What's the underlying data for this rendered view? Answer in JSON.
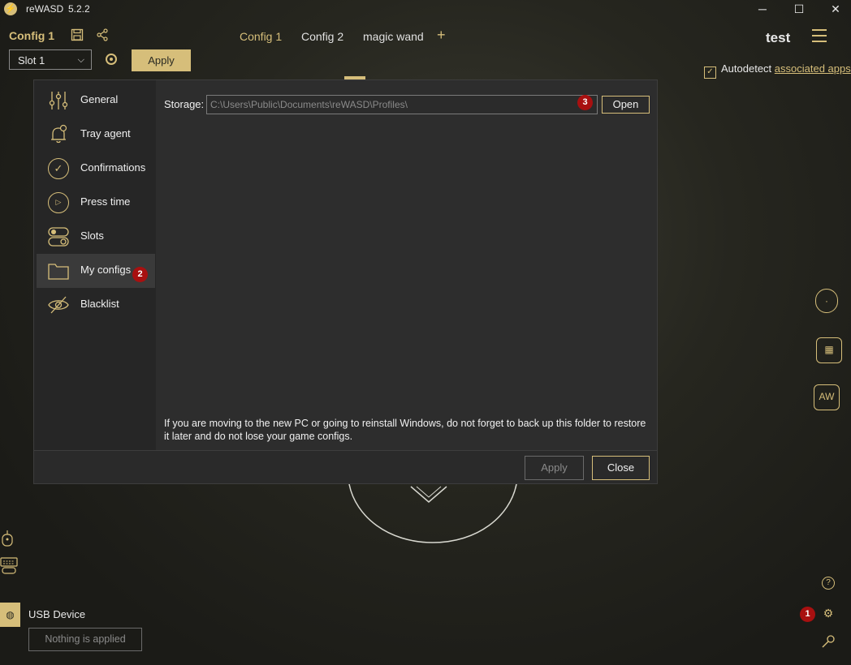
{
  "titlebar": {
    "app_name": "reWASD",
    "version": "5.2.2",
    "minimize": "─",
    "maximize": "☐",
    "close": "✕"
  },
  "header": {
    "config_title": "Config 1",
    "tabs": [
      {
        "label": "Config 1"
      },
      {
        "label": "Config 2"
      },
      {
        "label": "magic wand"
      }
    ],
    "add_tab": "+",
    "profile": "test"
  },
  "slot_row": {
    "slot_value": "Slot 1",
    "apply": "Apply"
  },
  "autodetect": {
    "label": "Autodetect",
    "link": "associated apps",
    "checked": true
  },
  "dialog": {
    "nav": [
      {
        "label": "General"
      },
      {
        "label": "Tray agent"
      },
      {
        "label": "Confirmations"
      },
      {
        "label": "Press time"
      },
      {
        "label": "Slots"
      },
      {
        "label": "My configs"
      },
      {
        "label": "Blacklist"
      }
    ],
    "storage_label": "Storage:",
    "storage_path": "C:\\Users\\Public\\Documents\\reWASD\\Profiles\\",
    "open": "Open",
    "hint": "If you are moving to the new PC or going to reinstall Windows, do not forget to back up this folder to restore it later and do not lose your game configs.",
    "apply": "Apply",
    "close": "Close"
  },
  "badges": {
    "b1": "1",
    "b2": "2",
    "b3": "3"
  },
  "device": {
    "name": "USB Device",
    "status": "Nothing is applied"
  },
  "colors": {
    "accent": "#d6be7a",
    "badge": "#a81010",
    "dialog_bg": "#2d2d2d"
  }
}
